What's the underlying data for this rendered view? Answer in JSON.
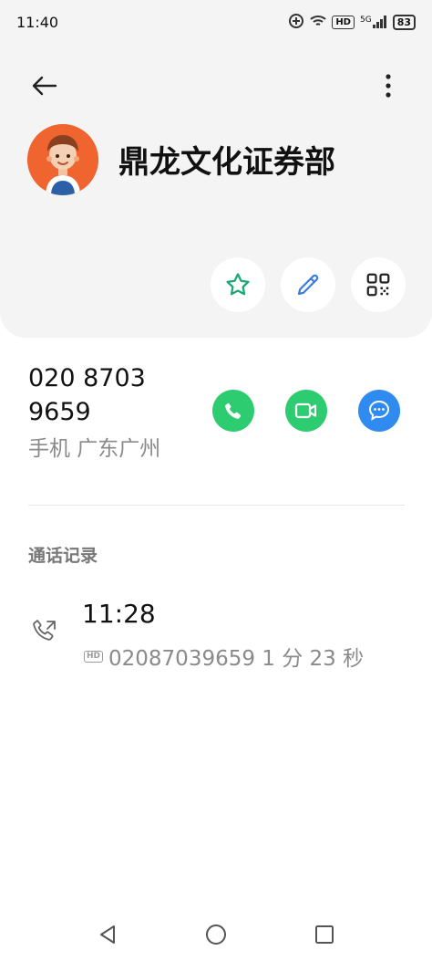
{
  "status_bar": {
    "time": "11:40",
    "network_label": "5G",
    "hd_label": "HD",
    "battery": "83"
  },
  "contact": {
    "name": "鼎龙文化证券部",
    "phone": "020 8703 9659",
    "phone_meta": "手机 广东广州"
  },
  "call_log": {
    "title": "通话记录",
    "entries": [
      {
        "time": "11:28",
        "hd": "HD",
        "detail": "02087039659 1 分 23 秒"
      }
    ]
  },
  "colors": {
    "header_bg": "#f4f4f4",
    "accent_green": "#1aa874",
    "call_green": "#2ecc71",
    "message_blue": "#2f8bf0",
    "pencil_blue": "#3a7be0",
    "avatar_bg": "#f06430"
  },
  "icons": {
    "back": "arrow-left-icon",
    "more": "more-vertical-icon",
    "favorite": "star-icon",
    "edit": "pencil-icon",
    "qr": "qr-code-icon",
    "call": "phone-icon",
    "video": "video-camera-icon",
    "message": "chat-bubble-icon",
    "call_log": "outgoing-call-icon"
  }
}
